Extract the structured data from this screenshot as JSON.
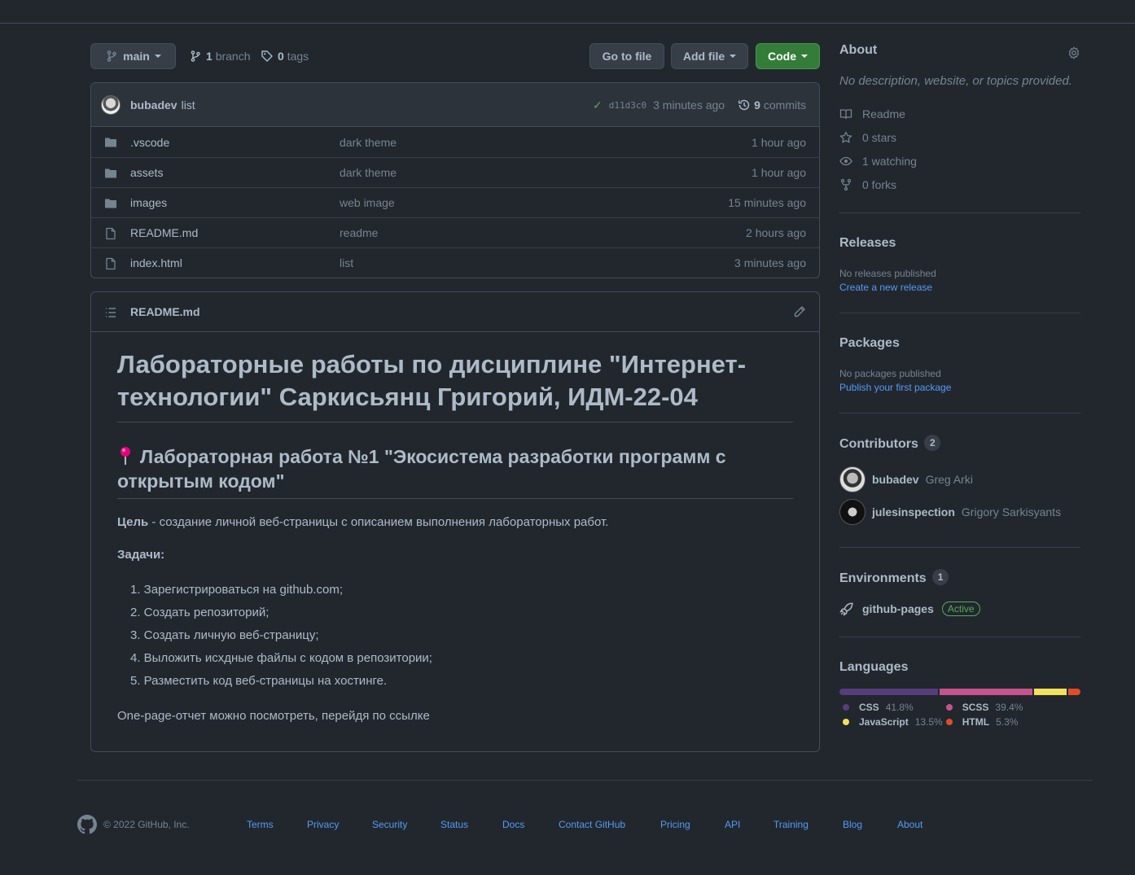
{
  "toolbar": {
    "branch": "main",
    "branch_count": "1",
    "branch_word": "branch",
    "tag_count": "0",
    "tag_word": "tags",
    "goto_file": "Go to file",
    "add_file": "Add file",
    "code": "Code"
  },
  "commit": {
    "author": "bubadev",
    "message": "list",
    "sha": "d11d3c0",
    "time": "3 minutes ago",
    "count": "9",
    "count_word": "commits"
  },
  "files": [
    {
      "name": ".vscode",
      "type": "folder",
      "message": "dark theme",
      "age": "1 hour ago"
    },
    {
      "name": "assets",
      "type": "folder",
      "message": "dark theme",
      "age": "1 hour ago"
    },
    {
      "name": "images",
      "type": "folder",
      "message": "web image",
      "age": "15 minutes ago"
    },
    {
      "name": "README.md",
      "type": "file",
      "message": "readme",
      "age": "2 hours ago"
    },
    {
      "name": "index.html",
      "type": "file",
      "message": "list",
      "age": "3 minutes ago"
    }
  ],
  "readme": {
    "file_title": "README.md",
    "h1": "Лабораторные работы по дисциплине \"Интернет-технологии\" Саркисьянц Григорий, ИДМ-22-04",
    "h2": "Лабораторная работа №1 \"Экосистема разработки программ с открытым кодом\"",
    "goal_label": "Цель",
    "goal_text": " - создание личной веб-страницы с описанием выполнения лабораторных работ.",
    "tasks_label": "Задачи:",
    "tasks": [
      "1. Зарегистрироваться на github.com;",
      "2. Создать репозиторий;",
      "3. Создать личную веб-страницу;",
      "4. Выложить исхдные файлы с кодом в репозитории;",
      "5. Разместить код веб-страницы на хостинге."
    ],
    "footer_text": "One-page-отчет можно посмотреть, перейдя по ссылке"
  },
  "about": {
    "title": "About",
    "description": "No description, website, or topics provided.",
    "readme": "Readme",
    "stars": "0 stars",
    "watching": "1 watching",
    "forks": "0 forks"
  },
  "releases": {
    "title": "Releases",
    "none": "No releases published",
    "link": "Create a new release"
  },
  "packages": {
    "title": "Packages",
    "none": "No packages published",
    "link": "Publish your first package"
  },
  "contributors": {
    "title": "Contributors",
    "count": "2",
    "people": [
      {
        "login": "bubadev",
        "name": "Greg Arki"
      },
      {
        "login": "julesinspection",
        "name": "Grigory Sarkisyants"
      }
    ]
  },
  "environments": {
    "title": "Environments",
    "count": "1",
    "name": "github-pages",
    "status": "Active"
  },
  "languages": {
    "title": "Languages",
    "items": [
      {
        "name": "CSS",
        "percent": "41.8%",
        "value": 41.8,
        "color": "#563d7c"
      },
      {
        "name": "SCSS",
        "percent": "39.4%",
        "value": 39.4,
        "color": "#c6538c"
      },
      {
        "name": "JavaScript",
        "percent": "13.5%",
        "value": 13.5,
        "color": "#f1e05a"
      },
      {
        "name": "HTML",
        "percent": "5.3%",
        "value": 5.3,
        "color": "#e34c26"
      }
    ]
  },
  "footer": {
    "copyright": "© 2022 GitHub, Inc.",
    "links": [
      "Terms",
      "Privacy",
      "Security",
      "Status",
      "Docs",
      "Contact GitHub",
      "Pricing",
      "API",
      "Training",
      "Blog",
      "About"
    ]
  },
  "colors": {
    "background": "#22272e",
    "accent_green": "#347d39",
    "link_blue": "#539bf5"
  }
}
